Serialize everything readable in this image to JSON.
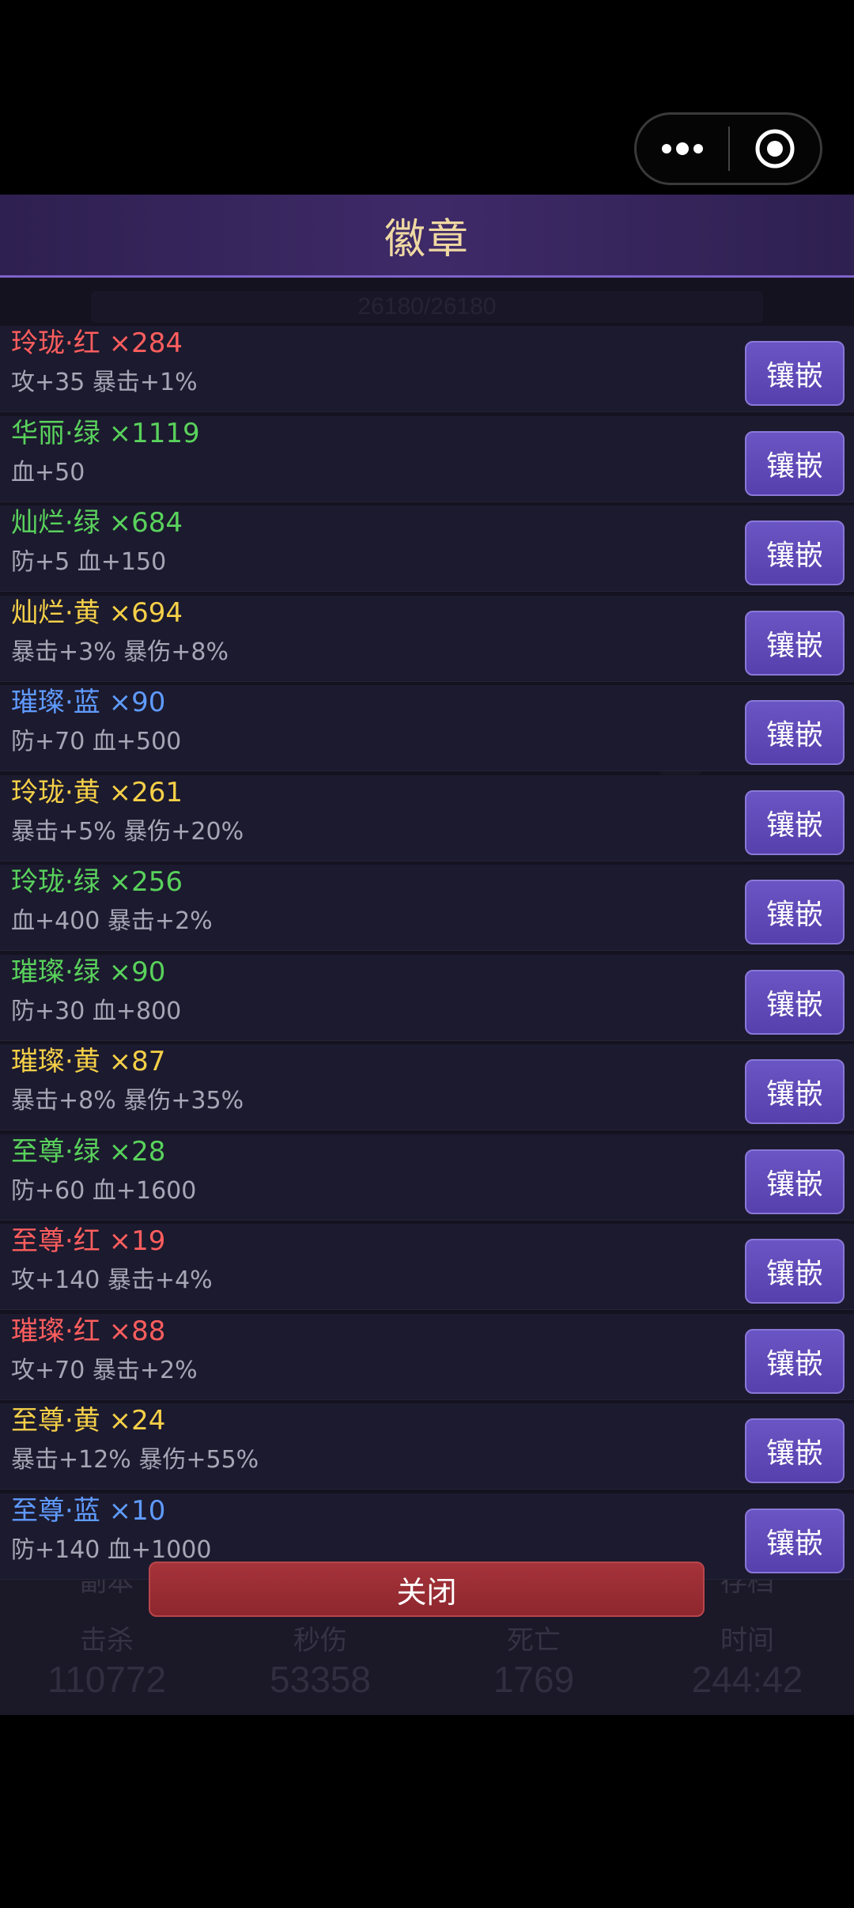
{
  "capsule": {
    "more_icon": "more-dots-icon",
    "close_icon": "target-circle-icon"
  },
  "title": "徽章",
  "background": {
    "hp_text": "26180/26180",
    "tabs": [
      "副本",
      "",
      "",
      "存档"
    ],
    "stat_labels": [
      "击杀",
      "秒伤",
      "死亡",
      "时间"
    ],
    "stat_values": [
      "110772",
      "53358",
      "1769",
      "244:42"
    ]
  },
  "badges": [
    {
      "name": "玲珑·红 ×284",
      "effect": "攻+35 暴击+1%",
      "color": "red"
    },
    {
      "name": "华丽·绿 ×1119",
      "effect": "血+50",
      "color": "green"
    },
    {
      "name": "灿烂·绿 ×684",
      "effect": "防+5 血+150",
      "color": "green"
    },
    {
      "name": "灿烂·黄 ×694",
      "effect": "暴击+3% 暴伤+8%",
      "color": "yellow"
    },
    {
      "name": "璀璨·蓝 ×90",
      "effect": "防+70 血+500",
      "color": "blue"
    },
    {
      "name": "玲珑·黄 ×261",
      "effect": "暴击+5% 暴伤+20%",
      "color": "yellow"
    },
    {
      "name": "玲珑·绿 ×256",
      "effect": "血+400 暴击+2%",
      "color": "green"
    },
    {
      "name": "璀璨·绿 ×90",
      "effect": "防+30 血+800",
      "color": "green"
    },
    {
      "name": "璀璨·黄 ×87",
      "effect": "暴击+8% 暴伤+35%",
      "color": "yellow"
    },
    {
      "name": "至尊·绿 ×28",
      "effect": "防+60 血+1600",
      "color": "green"
    },
    {
      "name": "至尊·红 ×19",
      "effect": "攻+140 暴击+4%",
      "color": "red"
    },
    {
      "name": "璀璨·红 ×88",
      "effect": "攻+70 暴击+2%",
      "color": "red"
    },
    {
      "name": "至尊·黄 ×24",
      "effect": "暴击+12% 暴伤+55%",
      "color": "yellow"
    },
    {
      "name": "至尊·蓝 ×10",
      "effect": "防+140 血+1000",
      "color": "blue"
    }
  ],
  "inlay_label": "镶嵌",
  "close_label": "关闭",
  "colors": {
    "red": "#ff5e5e",
    "green": "#59d25c",
    "yellow": "#f5d048",
    "blue": "#5f9bff",
    "title": "#f0d9a2",
    "inlay_button": "#5f4abb",
    "close_button": "#9b2e35"
  }
}
